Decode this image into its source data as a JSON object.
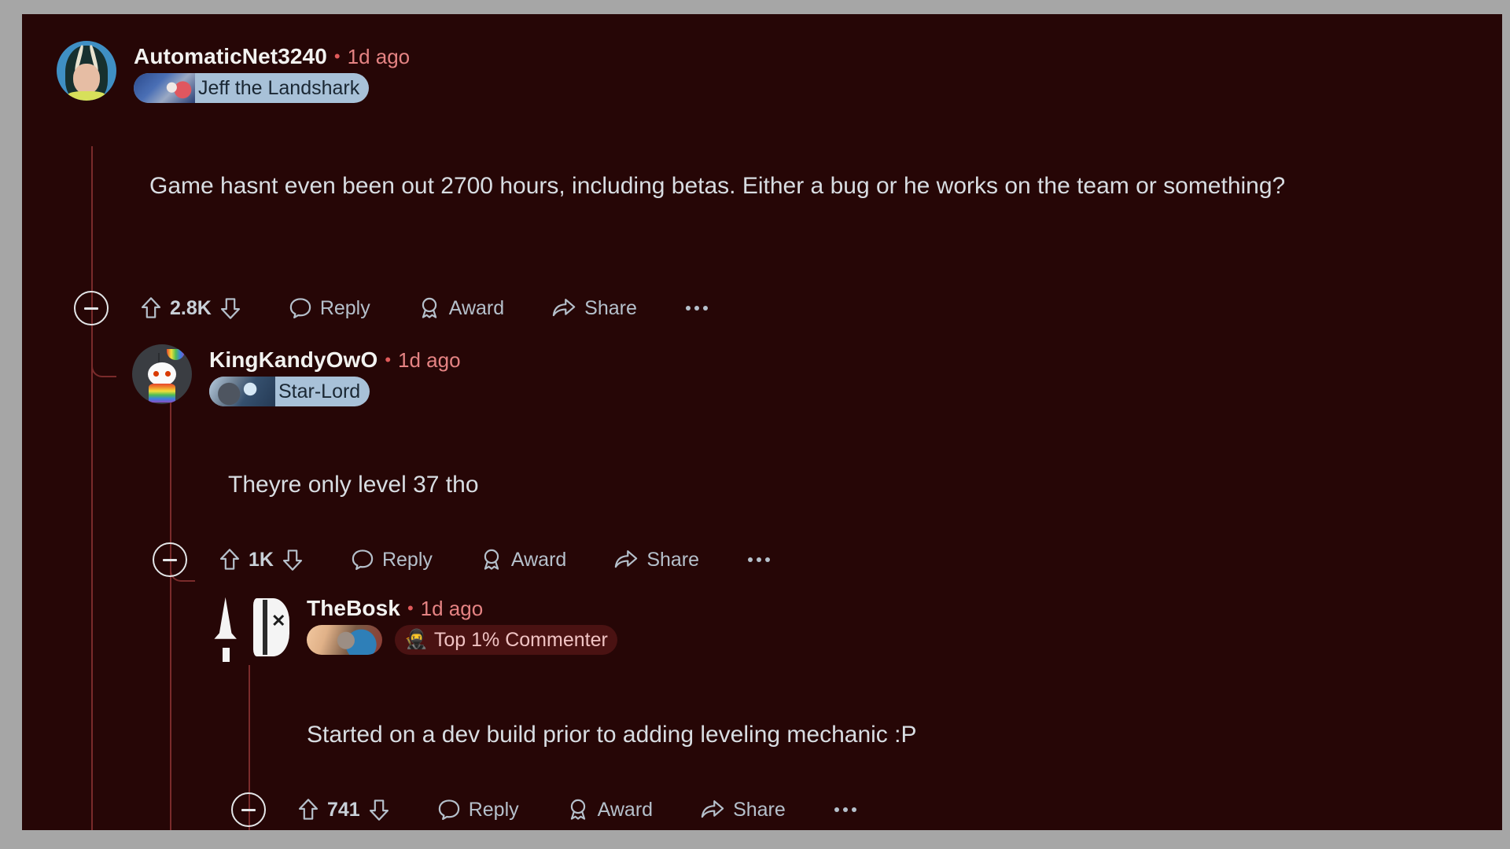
{
  "theme": {
    "background": "#260606",
    "text": "#d8dde2",
    "username": "#f2f2f0",
    "timestamp": "#e58383",
    "thread_line": "#7a2b2b",
    "action_text": "#b5c0cb",
    "flair_blue_bg": "#a8c1d8",
    "flair_dark_bg": "#4a1212"
  },
  "comments": [
    {
      "id": "comment-1",
      "depth": 0,
      "username": "AutomaticNet3240",
      "separator": "•",
      "timestamp": "1d ago",
      "avatar_name": "anime-character-avatar",
      "flairs": [
        {
          "type": "blue",
          "label": "Jeff the Landshark",
          "art": "shark-artwork"
        }
      ],
      "body": "Game hasnt even been out 2700 hours, including betas. Either a bug or he works on the team or something?",
      "actions": {
        "collapse": "collapse-thread",
        "upvote": "upvote",
        "votes": "2.8K",
        "downvote": "downvote",
        "reply": "Reply",
        "award": "Award",
        "share": "Share",
        "more": "more-options"
      }
    },
    {
      "id": "comment-2",
      "depth": 1,
      "username": "KingKandyOwO",
      "separator": "•",
      "timestamp": "1d ago",
      "avatar_name": "reddit-snoo-rainbow-avatar",
      "flairs": [
        {
          "type": "blue",
          "label": "Star-Lord",
          "art": "starlord-artwork"
        }
      ],
      "body": "Theyre only level 37 tho",
      "actions": {
        "collapse": "collapse-thread",
        "upvote": "upvote",
        "votes": "1K",
        "downvote": "downvote",
        "reply": "Reply",
        "award": "Award",
        "share": "Share",
        "more": "more-options"
      }
    },
    {
      "id": "comment-3",
      "depth": 2,
      "username": "TheBosk",
      "separator": "•",
      "timestamp": "1d ago",
      "avatar_name": "white-emblem-avatar",
      "flairs": [
        {
          "type": "blue-art-only",
          "label": "",
          "art": "rocket-raccoon-artwork"
        },
        {
          "type": "dark",
          "label": "Top 1% Commenter",
          "art": "ninja-emoji",
          "emoji": "🥷"
        }
      ],
      "body": "Started on a dev build prior to adding leveling mechanic :P",
      "actions": {
        "collapse": "collapse-thread",
        "upvote": "upvote",
        "votes": "741",
        "downvote": "downvote",
        "reply": "Reply",
        "award": "Award",
        "share": "Share",
        "more": "more-options"
      }
    }
  ]
}
